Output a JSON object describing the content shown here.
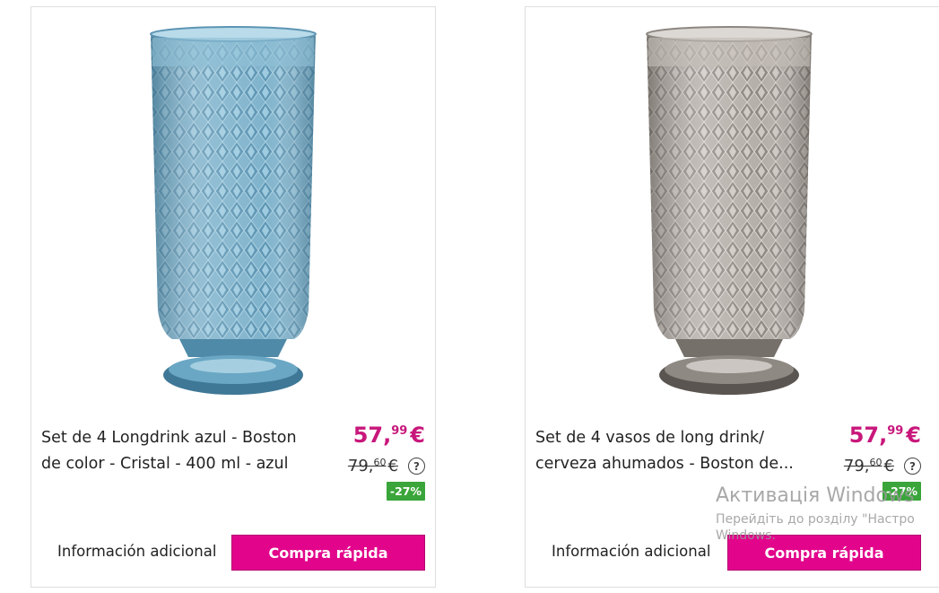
{
  "products": [
    {
      "title_line1": "Set de 4 Longdrink azul - Boston",
      "title_line2": "de color - Cristal - 400 ml - azul",
      "price_int": "57,",
      "price_dec": "99",
      "price_cur": "€",
      "old_int": "79,",
      "old_dec": "60",
      "old_cur": "€",
      "help": "?",
      "discount": "-27%",
      "info_label": "Información adicional",
      "buy_label": "Compra rápida",
      "glass_color": "#6ea9c4"
    },
    {
      "title_line1": "Set de 4 vasos de long drink/",
      "title_line2": "cerveza ahumados - Boston de...",
      "price_int": "57,",
      "price_dec": "99",
      "price_cur": "€",
      "old_int": "79,",
      "old_dec": "60",
      "old_cur": "€",
      "help": "?",
      "discount": "-27%",
      "info_label": "Información adicional",
      "buy_label": "Compra rápida",
      "glass_color": "#a8a29c"
    }
  ],
  "watermark": {
    "title": "Активація Windows",
    "subtitle_line1": "Перейдіть до розділу \"Настро",
    "subtitle_line2": "Windows."
  }
}
